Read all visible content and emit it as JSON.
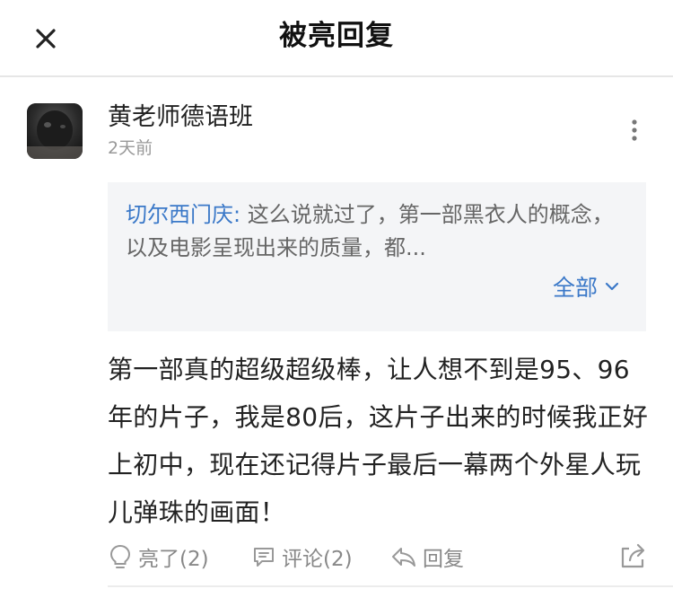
{
  "header": {
    "title": "被亮回复",
    "close_icon": "close-icon"
  },
  "post": {
    "username": "黄老师德语班",
    "timestamp": "2天前",
    "quote": {
      "author": "切尔西门庆:",
      "text": " 这么说就过了，第一部黑衣人的概念，以及电影呈现出来的质量，都...",
      "expand_label": "全部"
    },
    "body": "第一部真的超级超级棒，让人想不到是95、96年的片子，我是80后，这片子出来的时候我正好上初中，现在还记得片子最后一幕两个外星人玩儿弹珠的画面！",
    "actions": {
      "like_label": "亮了(2)",
      "comment_label": "评论(2)",
      "reply_label": "回复"
    }
  },
  "colors": {
    "accent": "#3a78c8",
    "muted": "#888888",
    "quote_bg": "#f4f5f7"
  }
}
